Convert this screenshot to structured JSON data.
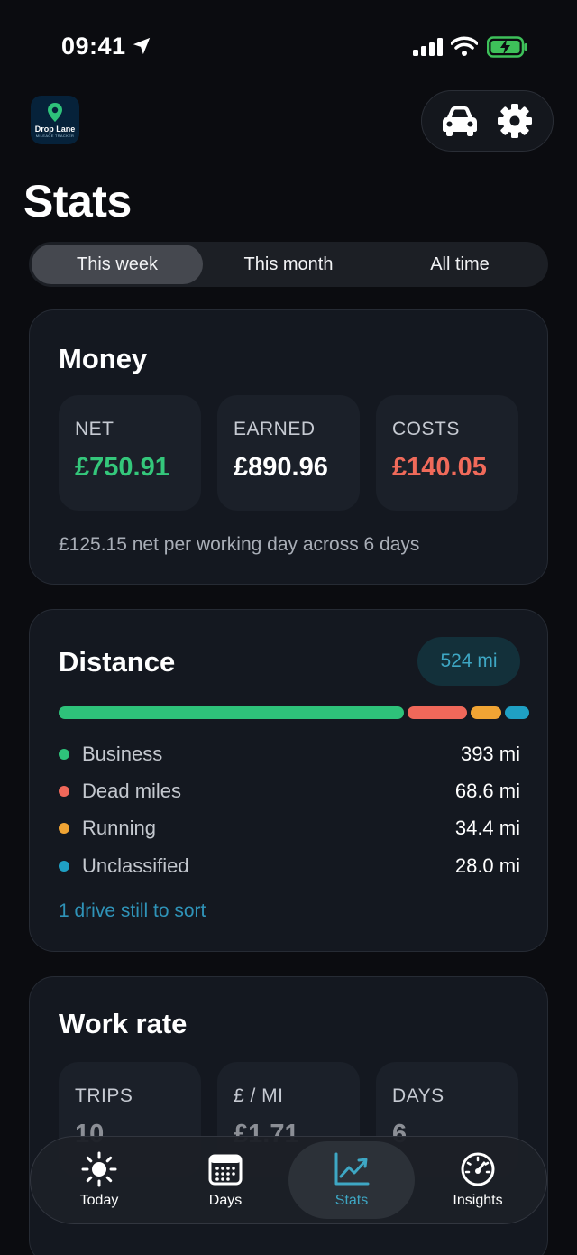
{
  "status": {
    "time": "09:41"
  },
  "app": {
    "logo_name": "Drop Lane",
    "logo_tagline": "MILEAGE TRACKER"
  },
  "page": {
    "title": "Stats"
  },
  "periods": [
    {
      "label": "This week",
      "active": true
    },
    {
      "label": "This month",
      "active": false
    },
    {
      "label": "All time",
      "active": false
    }
  ],
  "money": {
    "title": "Money",
    "tiles": [
      {
        "label": "NET",
        "value": "£750.91",
        "color": "#34c77b"
      },
      {
        "label": "EARNED",
        "value": "£890.96",
        "color": "#ffffff"
      },
      {
        "label": "COSTS",
        "value": "£140.05",
        "color": "#f06a5a"
      }
    ],
    "summary": "£125.15 net per working day across 6 days"
  },
  "distance": {
    "title": "Distance",
    "total_badge": "524 mi",
    "categories": [
      {
        "label": "Business",
        "value": "393 mi",
        "miles": 393,
        "color": "#2ec27a"
      },
      {
        "label": "Dead miles",
        "value": "68.6 mi",
        "miles": 68.6,
        "color": "#f0685a"
      },
      {
        "label": "Running",
        "value": "34.4 mi",
        "miles": 34.4,
        "color": "#f0a434"
      },
      {
        "label": "Unclassified",
        "value": "28.0 mi",
        "miles": 28.0,
        "color": "#1fa0c4"
      }
    ],
    "sort_link": "1 drive still to sort"
  },
  "work_rate": {
    "title": "Work rate",
    "tiles": [
      {
        "label": "TRIPS",
        "value": "10"
      },
      {
        "label": "£ / MI",
        "value": "£1.71"
      },
      {
        "label": "DAYS",
        "value": "6"
      }
    ]
  },
  "nav": [
    {
      "label": "Today",
      "icon": "sun-icon",
      "active": false
    },
    {
      "label": "Days",
      "icon": "calendar-icon",
      "active": false
    },
    {
      "label": "Stats",
      "icon": "chart-icon",
      "active": true
    },
    {
      "label": "Insights",
      "icon": "speedometer-icon",
      "active": false
    }
  ],
  "colors": {
    "accent": "#3ea7c4",
    "positive": "#34c77b",
    "negative": "#f06a5a"
  }
}
